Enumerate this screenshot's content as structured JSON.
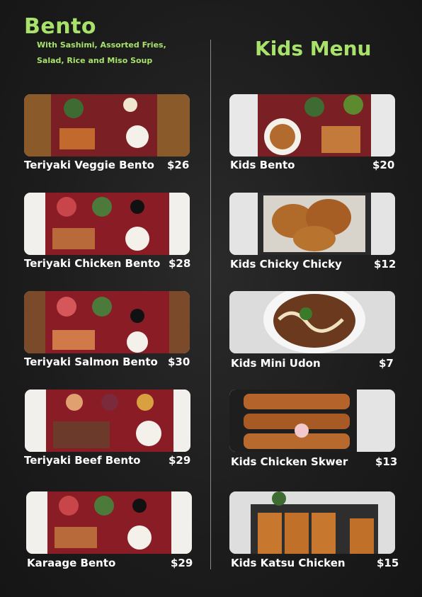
{
  "bento": {
    "title": "Bento",
    "subtitle_line1": "With Sashimi, Assorted Fries,",
    "subtitle_line2": "Salad, Rice and Miso Soup",
    "items": [
      {
        "name": "Teriyaki Veggie Bento",
        "price": "$26"
      },
      {
        "name": "Teriyaki Chicken Bento",
        "price": "$28"
      },
      {
        "name": "Teriyaki Salmon Bento",
        "price": "$30"
      },
      {
        "name": "Teriyaki Beef Bento",
        "price": "$29"
      },
      {
        "name": "Karaage Bento",
        "price": "$29"
      }
    ]
  },
  "kids": {
    "title": "Kids Menu",
    "items": [
      {
        "name": "Kids Bento",
        "price": "$20"
      },
      {
        "name": "Kids Chicky Chicky",
        "price": "$12"
      },
      {
        "name": "Kids Mini Udon",
        "price": "$7"
      },
      {
        "name": "Kids Chicken Skwer",
        "price": "$13"
      },
      {
        "name": "Kids Katsu Chicken",
        "price": "$15"
      }
    ]
  },
  "colors": {
    "accent": "#a8e26a",
    "background": "#1e1e1e"
  }
}
